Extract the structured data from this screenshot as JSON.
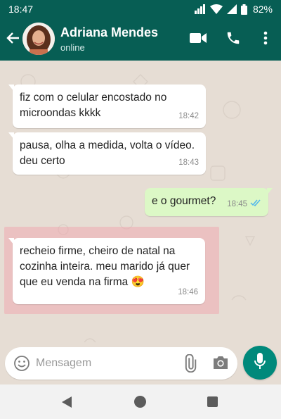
{
  "status_bar": {
    "time": "18:47",
    "battery_percent": "82%"
  },
  "header": {
    "contact_name": "Adriana Mendes",
    "contact_status": "online"
  },
  "messages": [
    {
      "direction": "in",
      "text": "fiz com o celular encostado no microondas kkkk",
      "time": "18:42"
    },
    {
      "direction": "in",
      "text": "pausa, olha a medida, volta o vídeo. deu certo",
      "time": "18:43"
    },
    {
      "direction": "out",
      "text": "e o gourmet?",
      "time": "18:45",
      "status": "read"
    },
    {
      "direction": "in",
      "text": "recheio firme, cheiro de natal na cozinha inteira. meu marido já quer que eu venda na firma 😍",
      "time": "18:46",
      "highlighted": true
    }
  ],
  "input": {
    "placeholder": "Mensagem",
    "value": ""
  },
  "colors": {
    "header": "#075e54",
    "incoming_bubble": "#ffffff",
    "outgoing_bubble": "#dcf8c6",
    "chat_background": "#e6ddd4",
    "mic_button": "#00897b",
    "read_ticks": "#4fb6ec",
    "highlight": "#f2a0aa"
  },
  "icons": [
    "back-arrow-icon",
    "video-call-icon",
    "phone-call-icon",
    "more-vert-icon",
    "emoji-icon",
    "attach-icon",
    "camera-icon",
    "mic-icon",
    "wifi-icon",
    "signal-icon",
    "battery-icon"
  ]
}
